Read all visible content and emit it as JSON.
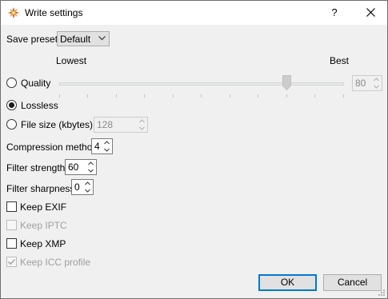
{
  "window": {
    "title": "Write settings",
    "help": "?"
  },
  "save_preset": {
    "label": "Save preset",
    "value": "Default"
  },
  "slider": {
    "min_label": "Lowest",
    "max_label": "Best",
    "level": 0.8
  },
  "quality": {
    "label": "Quality",
    "value": "80",
    "selected": false
  },
  "lossless": {
    "label": "Lossless",
    "selected": true
  },
  "file_size": {
    "label": "File size (kbytes)",
    "value": "128",
    "selected": false
  },
  "compression": {
    "label": "Compression method",
    "value": "4"
  },
  "filter_strength": {
    "label": "Filter strength",
    "value": "60"
  },
  "filter_sharpness": {
    "label": "Filter sharpness",
    "value": "0"
  },
  "keep_exif": {
    "label": "Keep EXIF",
    "checked": false,
    "enabled": true
  },
  "keep_iptc": {
    "label": "Keep IPTC",
    "checked": false,
    "enabled": false
  },
  "keep_xmp": {
    "label": "Keep XMP",
    "checked": false,
    "enabled": true
  },
  "keep_icc": {
    "label": "Keep ICC profile",
    "checked": true,
    "enabled": false
  },
  "buttons": {
    "ok": "OK",
    "cancel": "Cancel"
  },
  "colors": {
    "accent": "#0078d7",
    "background": "#f0f0f0",
    "disabled_text": "#a0a0a0"
  }
}
